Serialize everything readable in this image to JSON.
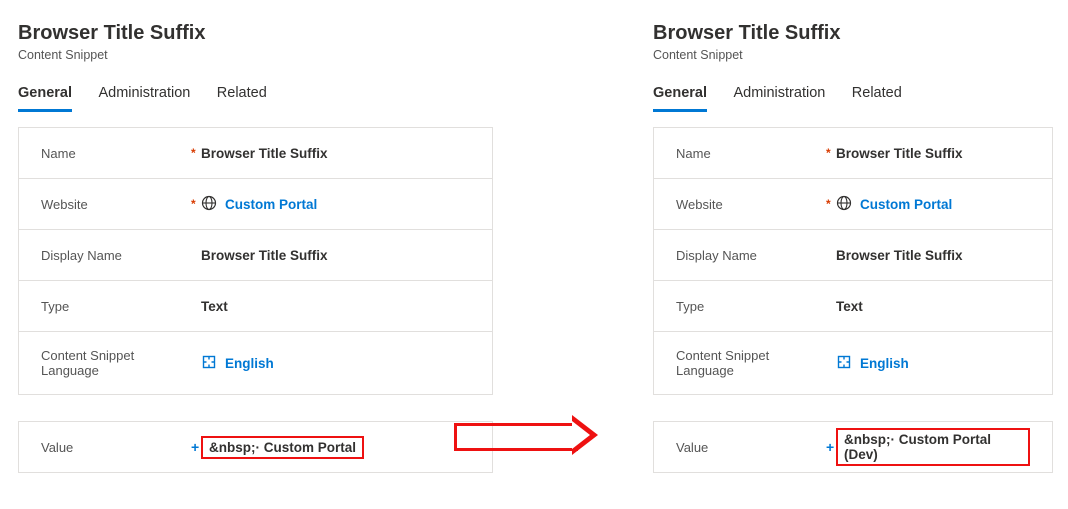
{
  "left": {
    "title": "Browser Title Suffix",
    "subtitle": "Content Snippet",
    "tabs": {
      "general": "General",
      "admin": "Administration",
      "related": "Related",
      "active": "general"
    },
    "fields": {
      "name": {
        "label": "Name",
        "value": "Browser Title Suffix",
        "required": true
      },
      "website": {
        "label": "Website",
        "value": "Custom Portal",
        "required": true,
        "isLookup": true,
        "icon": "globe-icon"
      },
      "displayName": {
        "label": "Display Name",
        "value": "Browser Title Suffix"
      },
      "type": {
        "label": "Type",
        "value": "Text"
      },
      "language": {
        "label": "Content Snippet Language",
        "value": "English",
        "isLookup": true,
        "icon": "puzzle-icon"
      },
      "value": {
        "label": "Value",
        "value": "&nbsp;· Custom Portal",
        "locked": true
      }
    }
  },
  "right": {
    "title": "Browser Title Suffix",
    "subtitle": "Content Snippet",
    "tabs": {
      "general": "General",
      "admin": "Administration",
      "related": "Related",
      "active": "general"
    },
    "fields": {
      "name": {
        "label": "Name",
        "value": "Browser Title Suffix",
        "required": true
      },
      "website": {
        "label": "Website",
        "value": "Custom Portal",
        "required": true,
        "isLookup": true,
        "icon": "globe-icon"
      },
      "displayName": {
        "label": "Display Name",
        "value": "Browser Title Suffix"
      },
      "type": {
        "label": "Type",
        "value": "Text"
      },
      "language": {
        "label": "Content Snippet Language",
        "value": "English",
        "isLookup": true,
        "icon": "puzzle-icon"
      },
      "value": {
        "label": "Value",
        "value": "&nbsp;· Custom Portal (Dev)",
        "locked": true
      }
    }
  }
}
